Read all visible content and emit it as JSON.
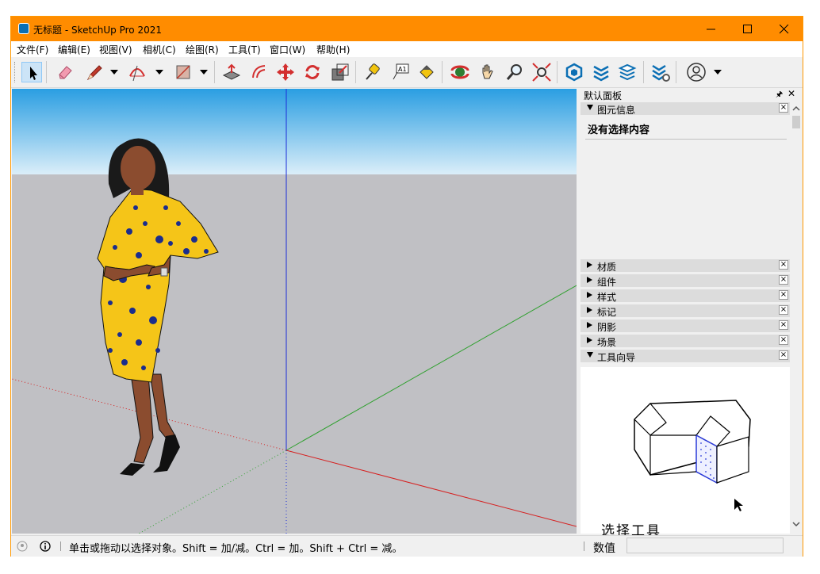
{
  "window": {
    "title": "无标题 - SketchUp Pro 2021",
    "accent_color": "#ff8c00"
  },
  "menu": [
    "文件(F)",
    "编辑(E)",
    "视图(V)",
    "相机(C)",
    "绘图(R)",
    "工具(T)",
    "窗口(W)",
    "帮助(H)"
  ],
  "toolbar": {
    "tools": [
      {
        "name": "select-tool-icon",
        "active": true
      },
      {
        "name": "eraser-tool-icon"
      },
      {
        "name": "pencil-line-tool-icon"
      },
      {
        "name": "arc-tool-icon"
      },
      {
        "name": "rectangle-tool-icon"
      },
      {
        "name": "push-pull-tool-icon"
      },
      {
        "name": "offset-tool-icon"
      },
      {
        "name": "move-tool-icon"
      },
      {
        "name": "rotate-tool-icon"
      },
      {
        "name": "scale-tool-icon"
      },
      {
        "name": "tape-measure-tool-icon"
      },
      {
        "name": "text-tool-icon"
      },
      {
        "name": "paint-bucket-tool-icon"
      },
      {
        "name": "orbit-tool-icon"
      },
      {
        "name": "pan-tool-icon"
      },
      {
        "name": "zoom-tool-icon"
      },
      {
        "name": "zoom-extents-tool-icon"
      },
      {
        "name": "warehouse-icon"
      },
      {
        "name": "extension-warehouse-icon"
      },
      {
        "name": "layout-send-icon"
      },
      {
        "name": "extension-manager-icon"
      },
      {
        "name": "account-icon"
      }
    ]
  },
  "tray": {
    "title": "默认面板",
    "entity_info": {
      "label": "图元信息",
      "content": "没有选择内容"
    },
    "panels": [
      "材质",
      "组件",
      "样式",
      "标记",
      "阴影",
      "场景",
      "工具向导"
    ],
    "instructor_title": "选择工具"
  },
  "status": {
    "message": "单击或拖动以选择对象。Shift = 加/减。Ctrl = 加。Shift + Ctrl = 减。",
    "measurements_label": "数值",
    "measurements_value": ""
  }
}
